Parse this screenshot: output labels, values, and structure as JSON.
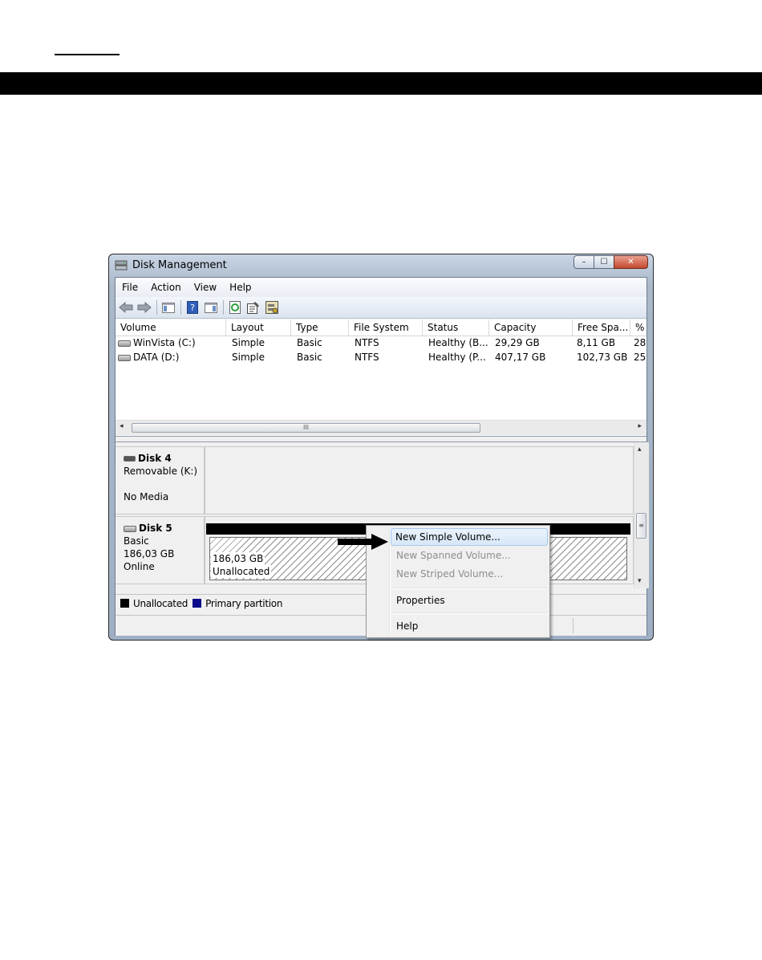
{
  "window": {
    "title": "Disk Management",
    "minimize": "–",
    "maximize": "☐",
    "close": "✕"
  },
  "menu": [
    "File",
    "Action",
    "View",
    "Help"
  ],
  "toolbar": {
    "icons": [
      "back-arrow-icon",
      "forward-arrow-icon",
      "console-tree-icon",
      "help-icon",
      "action-pane-icon",
      "refresh-icon",
      "properties-icon",
      "rescan-disks-icon"
    ]
  },
  "volumes": {
    "columns": [
      "Volume",
      "Layout",
      "Type",
      "File System",
      "Status",
      "Capacity",
      "Free Spa...",
      "% F"
    ],
    "rows": [
      [
        "WinVista (C:)",
        "Simple",
        "Basic",
        "NTFS",
        "Healthy (B...",
        "29,29 GB",
        "8,11 GB",
        "28"
      ],
      [
        "DATA (D:)",
        "Simple",
        "Basic",
        "NTFS",
        "Healthy (P...",
        "407,17 GB",
        "102,73 GB",
        "25"
      ]
    ],
    "scroll_thumb_grip": "III"
  },
  "disks": [
    {
      "name": "Disk 4",
      "line1": "Removable (K:)",
      "line2": "No Media"
    },
    {
      "name": "Disk 5",
      "line1": "Basic",
      "line2": "186,03 GB",
      "line3": "Online",
      "partition": {
        "size": "186,03 GB",
        "label": "Unallocated"
      }
    }
  ],
  "legend": [
    {
      "label": "Unallocated",
      "color": "#000000"
    },
    {
      "label": "Primary partition",
      "color": "#0a0a8a"
    }
  ],
  "context_menu": {
    "items": [
      {
        "label": "New Simple Volume...",
        "state": "highlighted"
      },
      {
        "label": "New Spanned Volume...",
        "state": "disabled"
      },
      {
        "label": "New Striped Volume...",
        "state": "disabled"
      },
      {
        "label": "Properties",
        "state": "enabled"
      },
      {
        "label": "Help",
        "state": "enabled"
      }
    ]
  }
}
